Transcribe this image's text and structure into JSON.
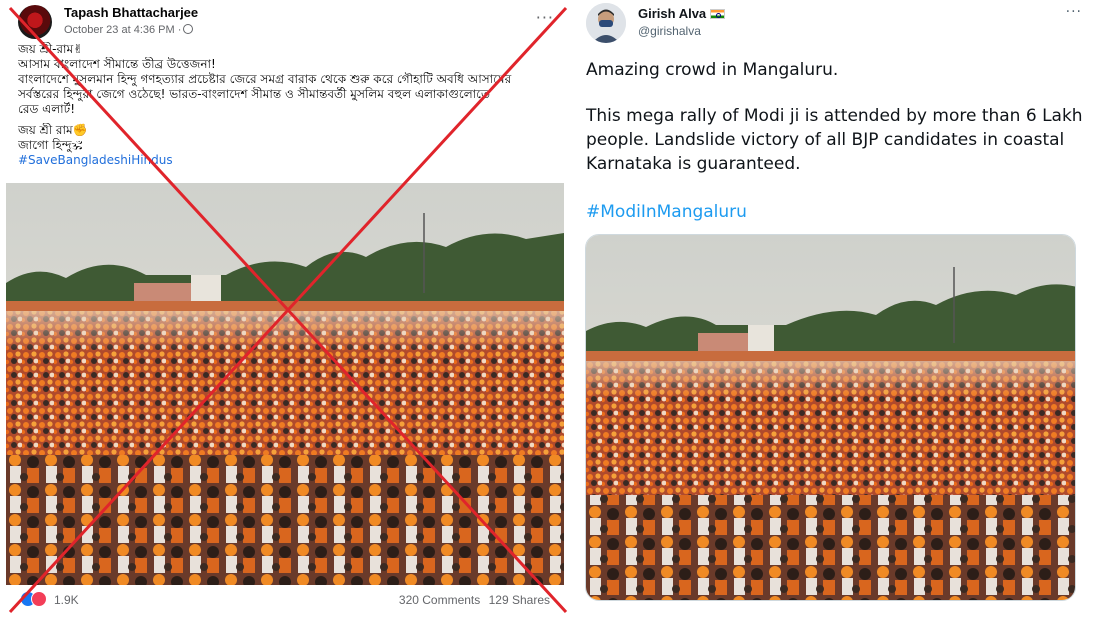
{
  "facebook_post": {
    "author_name": "Tapash Bhattacharjee",
    "timestamp": "October 23 at 4:36 PM ·",
    "more_label": "···",
    "lines": [
      "জয় শ্রী-রাম✌",
      "আসাম বাংলাদেশ সীমান্তে তীব্র উত্তেজনা!",
      "বাংলাদেশে মুসলমান হিন্দু গণহত্যার প্রচেষ্টার জেরে সমগ্র বারাক থেকে শুরু করে গৌহাটি অবধি আসামের",
      "সর্বস্তরের হিন্দুরা জেগে ওঠেছে! ভারত-বাংলাদেশ সীমান্ত ও সীমান্তবর্তী মুসলিম বহুল এলাকাগুলোতে",
      "রেড এলার্ট!"
    ],
    "lines2": [
      "জয় শ্রী রাম✊",
      "জাগো হিন্দু🕉"
    ],
    "hashtag": "#SaveBangladeshiHindus",
    "reaction_count": "1.9K",
    "comments": "320 Comments",
    "shares": "129 Shares",
    "reaction_icons": [
      "like-icon",
      "love-icon"
    ],
    "cross_color": "#e0242b"
  },
  "tweet": {
    "author_name": "Girish Alva",
    "handle": "@girishalva",
    "more_label": "···",
    "line1": "Amazing crowd in Mangaluru.",
    "para2": "This mega rally of Modi ji is attended by more than 6 Lakh people. Landslide victory of all BJP candidates in coastal Karnataka is guaranteed.",
    "hashtag": "#ModiInMangaluru",
    "flag_icon": "india-flag-icon",
    "accent_color": "#1d9bf0"
  }
}
